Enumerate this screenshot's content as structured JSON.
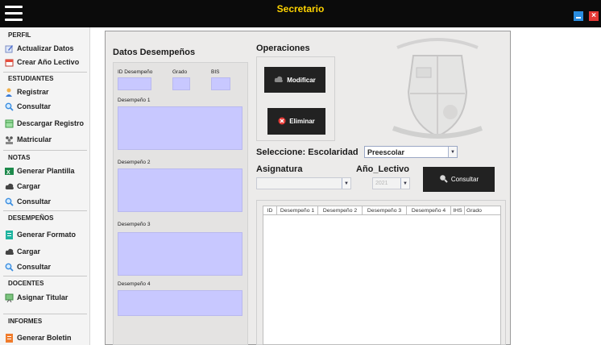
{
  "window": {
    "title": "Secretario"
  },
  "sidebar": {
    "perfil": {
      "header": "PERFIL",
      "items": [
        "Actualizar Datos",
        "Crear Año Lectivo"
      ]
    },
    "estudiantes": {
      "header": "ESTUDIANTES",
      "items": [
        "Registrar",
        "Consultar",
        "Descargar Registro",
        "Matricular"
      ]
    },
    "notas": {
      "header": "NOTAS",
      "items": [
        "Generar Plantilla",
        "Cargar",
        "Consultar"
      ]
    },
    "desempenos": {
      "header": "DESEMPEÑOS",
      "items": [
        "Generar Formato",
        "Cargar",
        "Consultar"
      ]
    },
    "docentes": {
      "header": "DOCENTES",
      "items": [
        "Asignar Titular"
      ]
    },
    "informes": {
      "header": "INFORMES",
      "items": [
        "Generar Boletin"
      ]
    }
  },
  "datos": {
    "title": "Datos Desempeños",
    "id_label": "ID Desempeño",
    "grado_label": "Grado",
    "bis_label": "BIS",
    "d1_label": "Desempeño 1",
    "d2_label": "Desempeño 2",
    "d3_label": "Desempeño 3",
    "d4_label": "Desempeño 4"
  },
  "operaciones": {
    "title": "Operaciones",
    "modificar_label": "Modificar",
    "eliminar_label": "Eliminar"
  },
  "filtros": {
    "escolaridad_label": "Seleccione: Escolaridad",
    "escolaridad_value": "Preescolar",
    "asignatura_label": "Asignatura",
    "asignatura_value": "",
    "anio_label": "Año_Lectivo",
    "anio_value": "2021",
    "consultar_label": "Consultar"
  },
  "table": {
    "columns": [
      "ID",
      "Desempeño 1",
      "Desempeño 2",
      "Desempeño 3",
      "Desempeño 4",
      "IHS",
      "Grado"
    ]
  },
  "colors": {
    "titlebar_bg": "#0b0b0b",
    "title_text": "#ffd400",
    "input_fill": "#c8c8ff",
    "dark_button": "#222222",
    "panel_bg": "#ecebea"
  }
}
